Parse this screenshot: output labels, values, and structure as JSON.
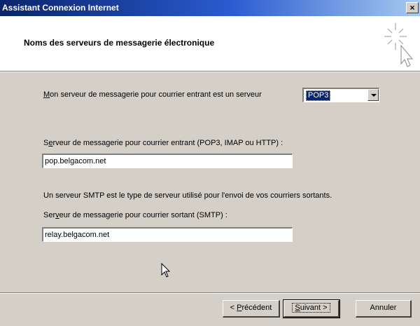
{
  "window": {
    "title": "Assistant Connexion Internet",
    "close_glyph": "×"
  },
  "header": {
    "title": "Noms des serveurs de messagerie électronique",
    "icon": "wizard-wand-icon"
  },
  "incoming_type": {
    "label_prefix": "",
    "label_accel": "M",
    "label_rest": "on serveur de messagerie pour courrier entrant est un serveur",
    "selected_value": "POP3"
  },
  "incoming_server": {
    "label_pre": "S",
    "label_accel": "e",
    "label_rest": "rveur de messagerie pour courrier entrant (POP3, IMAP ou HTTP) :",
    "value": "pop.belgacom.net"
  },
  "smtp_note": "Un serveur SMTP est le type de serveur utilisé pour l'envoi de vos courriers sortants.",
  "outgoing_server": {
    "label_pre": "Ser",
    "label_accel": "v",
    "label_rest": "eur de messagerie pour courrier sortant (SMTP) :",
    "value": "relay.belgacom.net"
  },
  "buttons": {
    "back_pre": "< ",
    "back_accel": "P",
    "back_rest": "récédent",
    "next_accel": "S",
    "next_rest": "uivant >",
    "cancel": "Annuler"
  }
}
